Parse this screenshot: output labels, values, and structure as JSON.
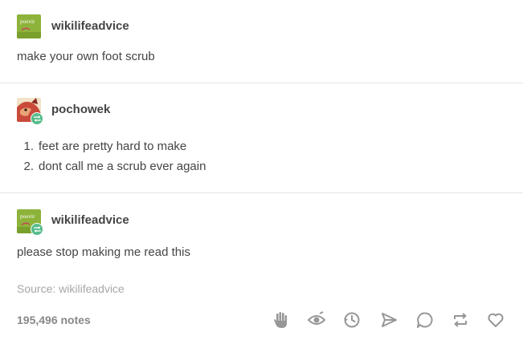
{
  "colors": {
    "text": "#444444",
    "muted": "#a7a7a7",
    "notes": "#888888",
    "divider": "#e4e4e4",
    "icon": "#979797",
    "reblog_green": "#56bc8a",
    "avatar_wiki_bg": "#8db33a",
    "avatar_pochowek_bg": "#c94a3a"
  },
  "posts": [
    {
      "avatar": "wikilifeadvice-avatar",
      "avatar_text": "poovir",
      "username": "wikilifeadvice",
      "text": "make your own foot scrub"
    },
    {
      "avatar": "pochowek-avatar",
      "username": "pochowek",
      "list": [
        {
          "num": "1.",
          "text": "feet are pretty hard to make"
        },
        {
          "num": "2.",
          "text": "dont call me a scrub ever again"
        }
      ]
    },
    {
      "avatar": "wikilifeadvice-avatar",
      "avatar_text": "poovir",
      "username": "wikilifeadvice",
      "text": "please stop making me read this"
    }
  ],
  "source": {
    "label": "Source:",
    "value": "wikilifeadvice"
  },
  "footer": {
    "notes": "195,496 notes",
    "actions": [
      "hand-wave-icon",
      "eye-icon",
      "history-icon",
      "share-icon",
      "reply-icon",
      "reblog-icon",
      "heart-icon"
    ]
  }
}
